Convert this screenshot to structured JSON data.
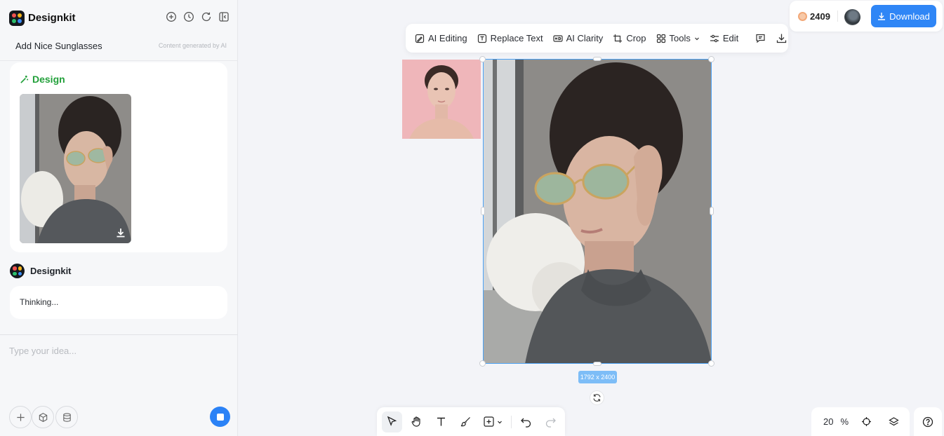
{
  "app": {
    "brand": "Designkit",
    "colors": {
      "accent": "#2f86f6",
      "design_green": "#22a03a",
      "selection": "#4da3f5"
    }
  },
  "left_panel": {
    "header_icons": [
      "add-circle-icon",
      "history-icon",
      "refresh-icon",
      "collapse-panel-icon"
    ],
    "chat_title": "Add Nice Sunglasses",
    "ai_note": "Content generated by AI",
    "design_card": {
      "label": "Design",
      "icon": "design-wand-icon"
    },
    "agent_name": "Designkit",
    "status_message": "Thinking...",
    "input": {
      "placeholder": "Type your idea..."
    },
    "bottom_buttons": [
      "add-icon",
      "cube-icon",
      "database-icon"
    ],
    "send_button": "stop-icon"
  },
  "top_right": {
    "credits": "2409",
    "download_label": "Download"
  },
  "toolbar": {
    "items": [
      {
        "label": "AI Editing",
        "icon": "ai-edit-icon"
      },
      {
        "label": "Replace Text",
        "icon": "replace-text-icon"
      },
      {
        "label": "AI Clarity",
        "icon": "hd-icon"
      },
      {
        "label": "Crop",
        "icon": "crop-icon"
      },
      {
        "label": "Tools",
        "icon": "grid-icon"
      },
      {
        "label": "Edit",
        "icon": "sliders-icon"
      }
    ],
    "trailing_icons": [
      "comment-icon",
      "download-icon"
    ]
  },
  "canvas": {
    "dimensions_label": "1792 x 2400"
  },
  "bottom_toolbar": {
    "tools": [
      "select-icon",
      "hand-icon",
      "text-icon",
      "brush-icon",
      "add-shape-icon",
      "undo-icon",
      "redo-icon"
    ]
  },
  "zoom": {
    "value": "20",
    "unit": "%"
  }
}
